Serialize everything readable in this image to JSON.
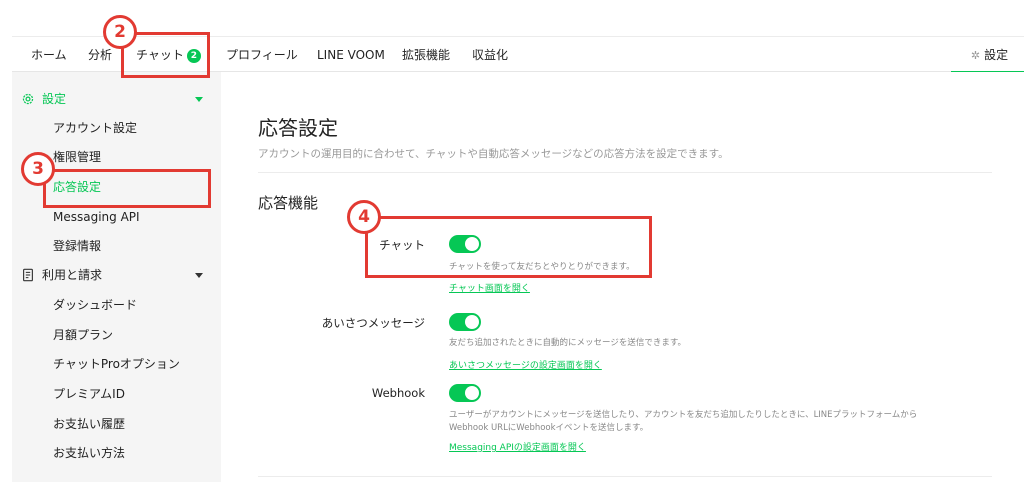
{
  "nav": {
    "home": "ホーム",
    "analysis": "分析",
    "chat": "チャット",
    "chat_badge": "2",
    "profile": "プロフィール",
    "voom": "LINE VOOM",
    "extensions": "拡張機能",
    "monetize": "収益化",
    "settings": "設定",
    "settings_icon": "gear-icon"
  },
  "sidebar": {
    "settings_header": "設定",
    "settings_items": [
      "アカウント設定",
      "権限管理",
      "応答設定",
      "Messaging API",
      "登録情報"
    ],
    "billing_header": "利用と請求",
    "billing_items": [
      "ダッシュボード",
      "月額プラン",
      "チャットProオプション",
      "プレミアムID",
      "お支払い履歴",
      "お支払い方法"
    ]
  },
  "main": {
    "title": "応答設定",
    "description": "アカウントの運用目的に合わせて、チャットや自動応答メッセージなどの応答方法を設定できます。",
    "section_title": "応答機能",
    "rows": [
      {
        "label": "チャット",
        "enabled": true,
        "description": "チャットを使って友だちとやりとりができます。",
        "link": "チャット画面を開く"
      },
      {
        "label": "あいさつメッセージ",
        "enabled": true,
        "description": "友だち追加されたときに自動的にメッセージを送信できます。",
        "link": "あいさつメッセージの設定画面を開く"
      },
      {
        "label": "Webhook",
        "enabled": true,
        "description_line1": "ユーザーがアカウントにメッセージを送信したり、アカウントを友だち追加したりしたときに、LINEプラットフォームから",
        "description_line2": "Webhook URLにWebhookイベントを送信します。",
        "link": "Messaging APIの設定画面を開く"
      }
    ]
  },
  "annotations": [
    "2",
    "3",
    "4"
  ],
  "colors": {
    "accent": "#06c755",
    "annotation": "#e23a32"
  }
}
